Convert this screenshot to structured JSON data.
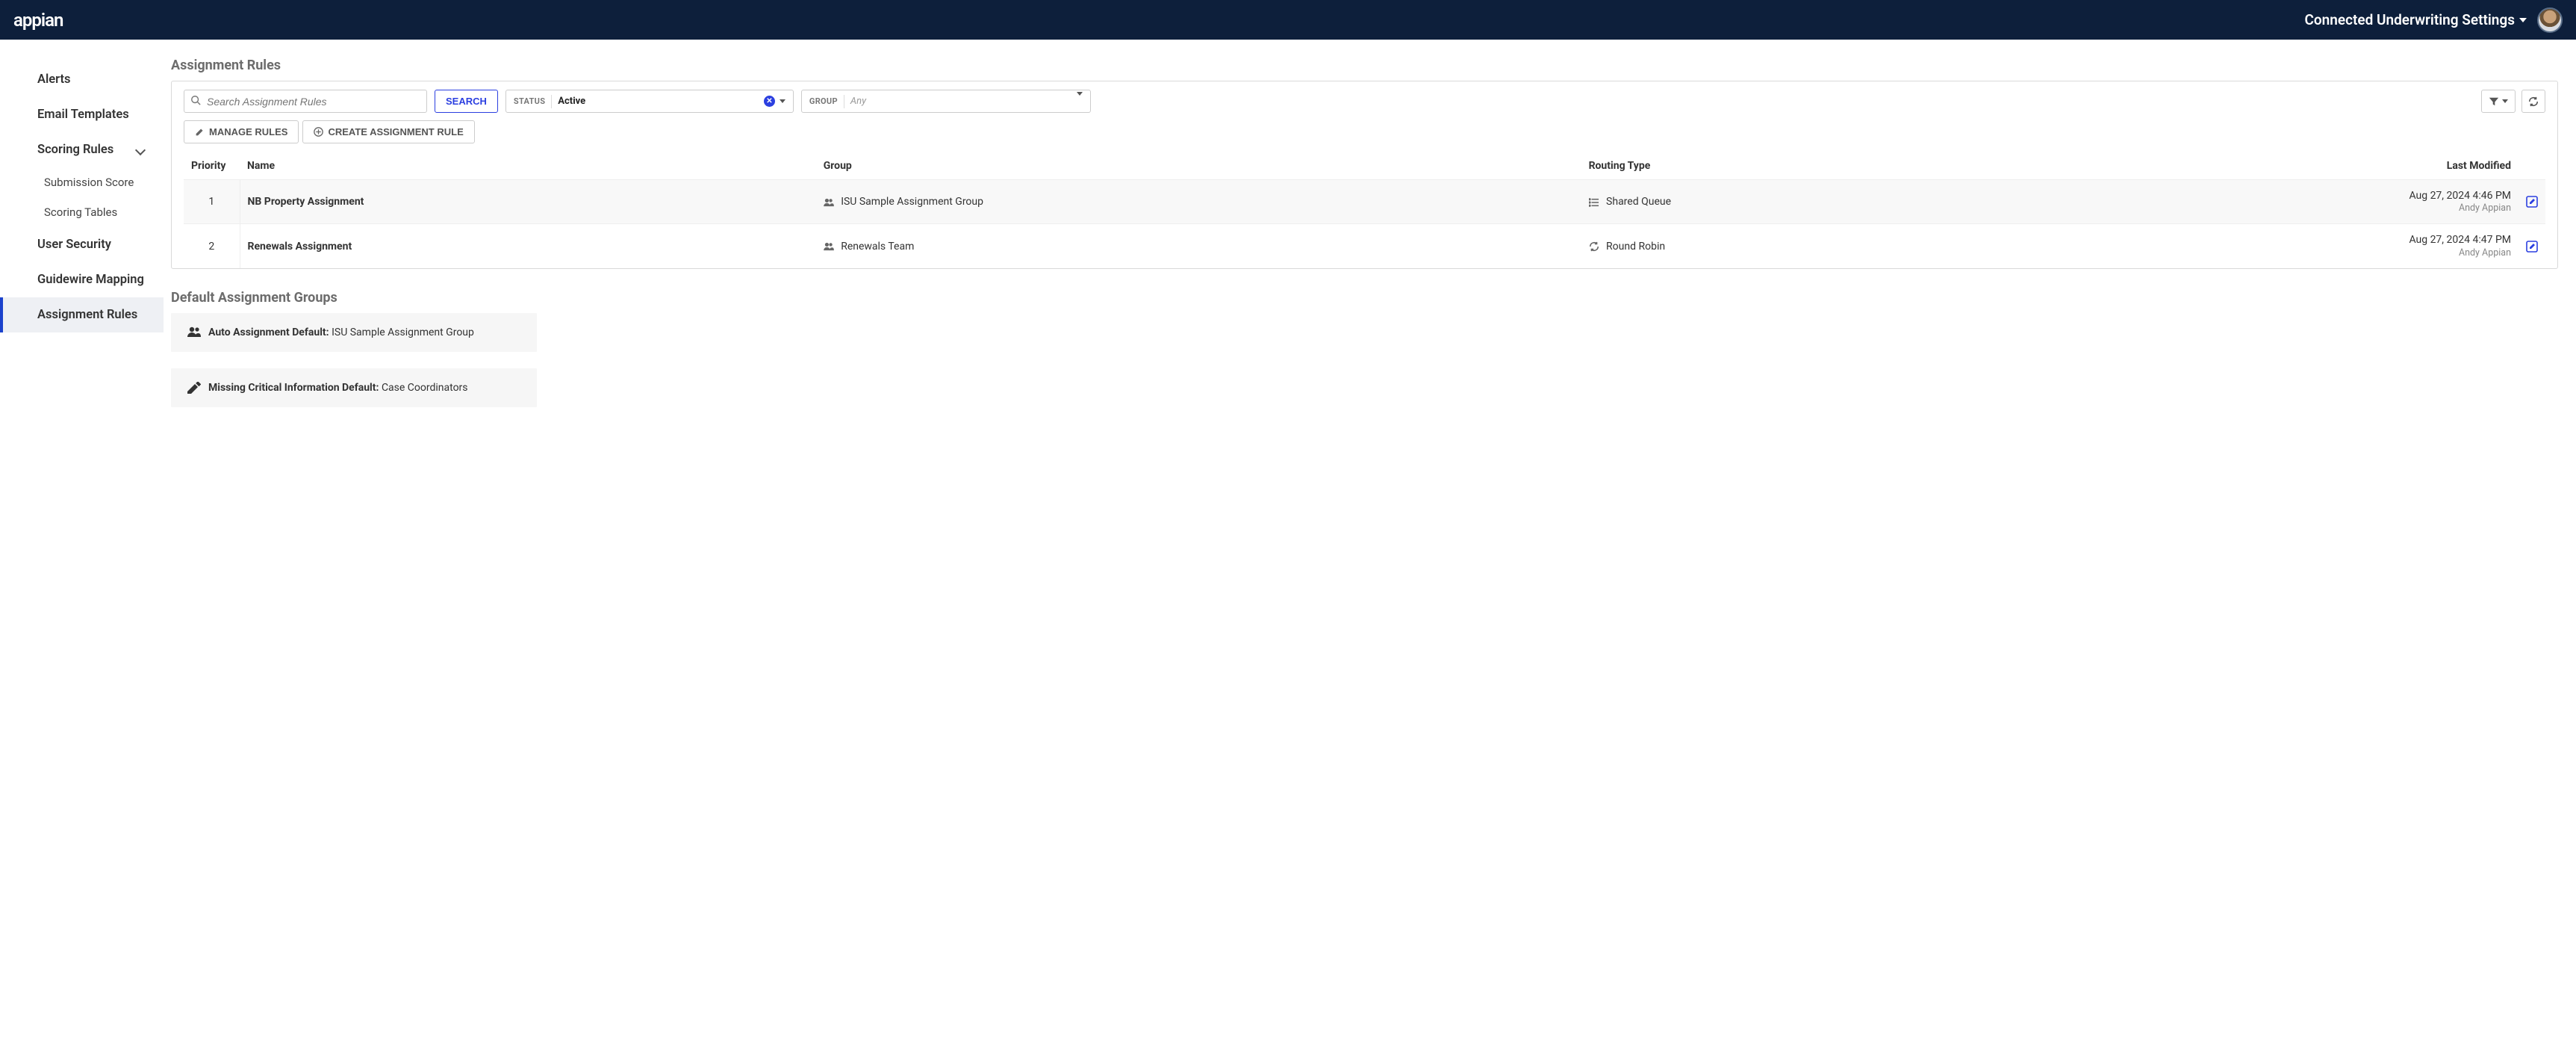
{
  "header": {
    "logo_text": "appian",
    "site_title": "Connected Underwriting Settings"
  },
  "sidebar": {
    "items": [
      {
        "label": "Alerts",
        "active": false
      },
      {
        "label": "Email Templates",
        "active": false
      },
      {
        "label": "Scoring Rules",
        "active": false,
        "expandable": true,
        "children": [
          {
            "label": "Submission Score"
          },
          {
            "label": "Scoring Tables"
          }
        ]
      },
      {
        "label": "User Security",
        "active": false
      },
      {
        "label": "Guidewire Mapping",
        "active": false
      },
      {
        "label": "Assignment Rules",
        "active": true
      }
    ]
  },
  "page": {
    "title": "Assignment Rules",
    "search": {
      "placeholder": "Search Assignment Rules",
      "button": "SEARCH"
    },
    "filters": {
      "status": {
        "label": "STATUS",
        "value": "Active"
      },
      "group": {
        "label": "GROUP",
        "placeholder": "Any"
      }
    },
    "actions": {
      "manage": "MANAGE RULES",
      "create": "CREATE ASSIGNMENT RULE"
    },
    "table": {
      "columns": {
        "priority": "Priority",
        "name": "Name",
        "group": "Group",
        "routing": "Routing Type",
        "modified": "Last Modified"
      },
      "rows": [
        {
          "priority": "1",
          "name": "NB Property Assignment",
          "group": "ISU Sample Assignment Group",
          "routing": "Shared Queue",
          "modified": "Aug 27, 2024 4:46 PM",
          "by": "Andy Appian"
        },
        {
          "priority": "2",
          "name": "Renewals Assignment",
          "group": "Renewals Team",
          "routing": "Round Robin",
          "modified": "Aug 27, 2024 4:47 PM",
          "by": "Andy Appian"
        }
      ]
    },
    "defaults": {
      "title": "Default Assignment Groups",
      "auto": {
        "label": "Auto Assignment Default:",
        "value": "ISU Sample Assignment Group"
      },
      "missing": {
        "label": "Missing Critical Information Default:",
        "value": "Case Coordinators"
      }
    }
  }
}
